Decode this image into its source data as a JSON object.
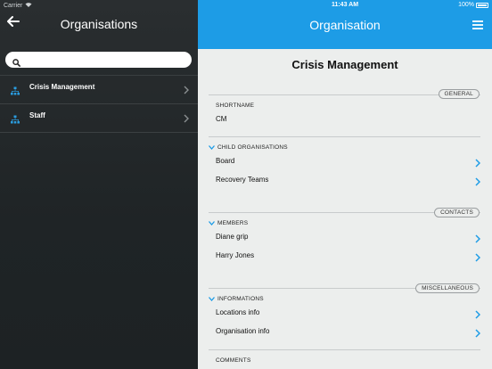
{
  "status": {
    "carrier": "Carrier",
    "time": "11:43 AM",
    "battery": "100%"
  },
  "left": {
    "title": "Organisations",
    "search": {
      "value": "",
      "placeholder": ""
    },
    "items": [
      {
        "label": "Crisis Management"
      },
      {
        "label": "Staff"
      }
    ]
  },
  "right": {
    "title": "Organisation",
    "org_name": "Crisis Management",
    "sections": {
      "general": "GENERAL",
      "contacts": "CONTACTS",
      "misc": "MISCELLANEOUS"
    },
    "shortname_label": "SHORTNAME",
    "shortname_value": "CM",
    "child_orgs_label": "CHILD ORGANISATIONS",
    "child_orgs": [
      "Board",
      "Recovery Teams"
    ],
    "members_label": "MEMBERS",
    "members": [
      "Diane grip",
      "Harry Jones"
    ],
    "informations_label": "INFORMATIONS",
    "informations": [
      "Locations info",
      "Organisation info"
    ],
    "comments_label": "COMMENTS"
  },
  "colors": {
    "accent": "#1d9ce6",
    "panel_dark": "#23282a",
    "content_bg": "#eceeed"
  }
}
